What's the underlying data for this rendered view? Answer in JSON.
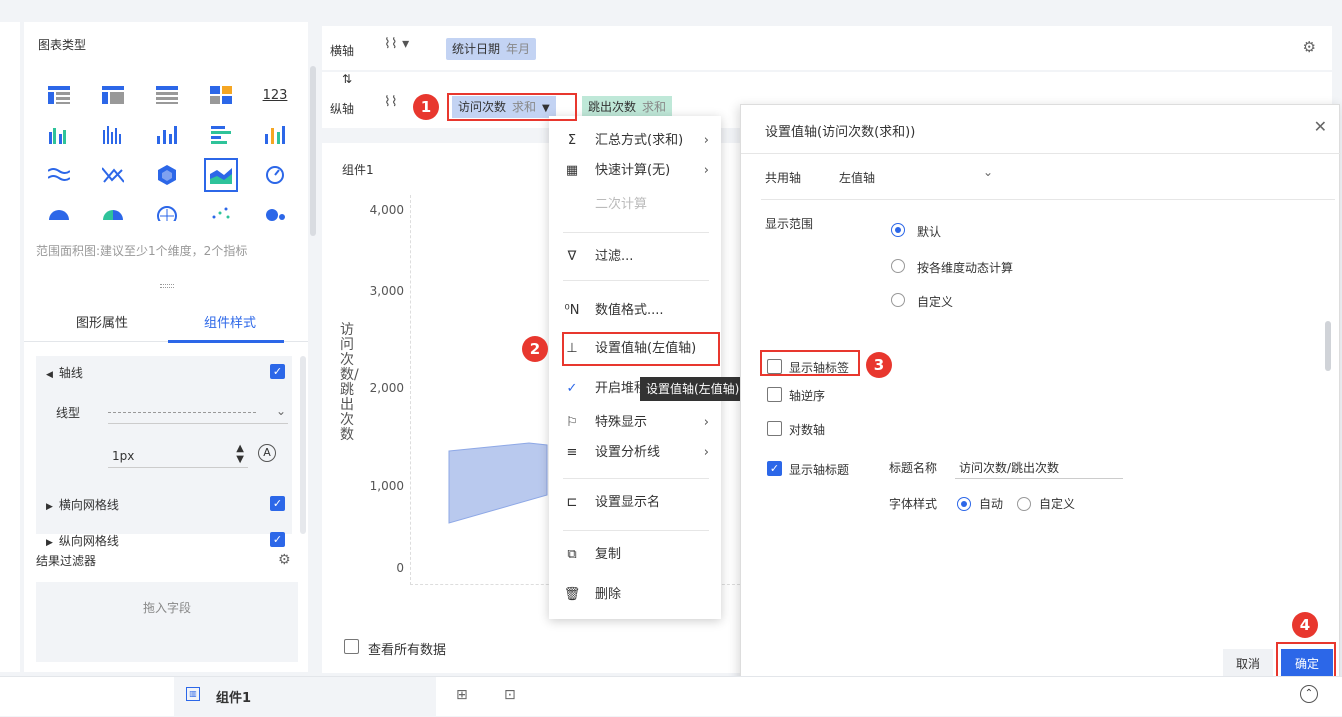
{
  "left_panel": {
    "chart_type_title": "图表类型",
    "icons": [
      "table-icon",
      "crosstab-icon",
      "detail-table-icon",
      "dashboard-table-icon",
      "kpi-number-icon",
      "grouped-bar-icon",
      "multi-bar-icon",
      "column-icon",
      "bar-icon",
      "stacked-column-icon",
      "line-icon",
      "scatter-icon",
      "map-icon",
      "area-icon",
      "gauge-icon",
      "pie-icon",
      "donut-icon",
      "radar-icon",
      "point-icon",
      "bubble-icon"
    ],
    "kpi_label": "123",
    "hint": "范围面积图:建议至少1个维度，2个指标",
    "tabs": [
      "图形属性",
      "组件样式"
    ],
    "active_tab": "组件样式",
    "axis_section": "轴线",
    "line_type_label": "线型",
    "line_width_value": "1px",
    "h_grid": "横向网格线",
    "v_grid": "纵向网格线",
    "result_filter": "结果过滤器",
    "drop_field": "拖入字段"
  },
  "axis": {
    "x_label": "横轴",
    "y_label": "纵轴",
    "x_field": "统计日期",
    "x_field_sub": "年月",
    "y_field1": "访问次数",
    "y_field1_sub": "求和",
    "y_field2": "跳出次数",
    "y_field2_sub": "求和"
  },
  "chart": {
    "component_title": "组件1",
    "y_title": "访问次数/跳出次数",
    "view_all": "查看所有数据"
  },
  "chart_data": {
    "type": "area",
    "title": "组件1",
    "ylabel": "访问次数/跳出次数",
    "yticks": [
      "4,000",
      "3,000",
      "2,000",
      "1,000",
      "0"
    ],
    "ylim": [
      0,
      4000
    ]
  },
  "context_menu": {
    "items": [
      {
        "icon": "Σ",
        "label": "汇总方式(求和)",
        "arrow": true
      },
      {
        "icon": "▦",
        "label": "快速计算(无)",
        "arrow": true
      },
      {
        "icon": "",
        "label": "二次计算",
        "disabled": true
      },
      {
        "icon": "∇",
        "label": "过滤..."
      },
      {
        "icon": "⁰N",
        "label": "数值格式...."
      },
      {
        "icon": "⊥",
        "label": "设置值轴(左值轴)"
      },
      {
        "icon": "✓",
        "label": "开启堆积"
      },
      {
        "icon": "⚐",
        "label": "特殊显示",
        "arrow": true
      },
      {
        "icon": "≡",
        "label": "设置分析线",
        "arrow": true
      },
      {
        "icon": "⊏",
        "label": "设置显示名"
      },
      {
        "icon": "⧉",
        "label": "复制"
      },
      {
        "icon": "🗑",
        "label": "删除"
      }
    ],
    "tooltip": "设置值轴(左值轴)"
  },
  "dialog": {
    "title": "设置值轴(访问次数(求和))",
    "shared_axis_label": "共用轴",
    "shared_axis_value": "左值轴",
    "display_range_label": "显示范围",
    "range_options": [
      "默认",
      "按各维度动态计算",
      "自定义"
    ],
    "show_axis_label": "显示轴标签",
    "axis_reverse": "轴逆序",
    "log_axis": "对数轴",
    "show_axis_title": "显示轴标题",
    "title_name_label": "标题名称",
    "title_name_value": "访问次数/跳出次数",
    "font_style_label": "字体样式",
    "font_auto": "自动",
    "font_custom": "自定义",
    "cancel": "取消",
    "ok": "确定"
  },
  "markers": [
    "1",
    "2",
    "3",
    "4"
  ],
  "bottom": {
    "sheet_tab": "组件1"
  },
  "colors": {
    "accent": "#2c67e8",
    "marker": "#e8372e",
    "area_fill": "#b9c9ee",
    "pill_blue": "#c3d3f3",
    "pill_green": "#bfe8d8"
  }
}
